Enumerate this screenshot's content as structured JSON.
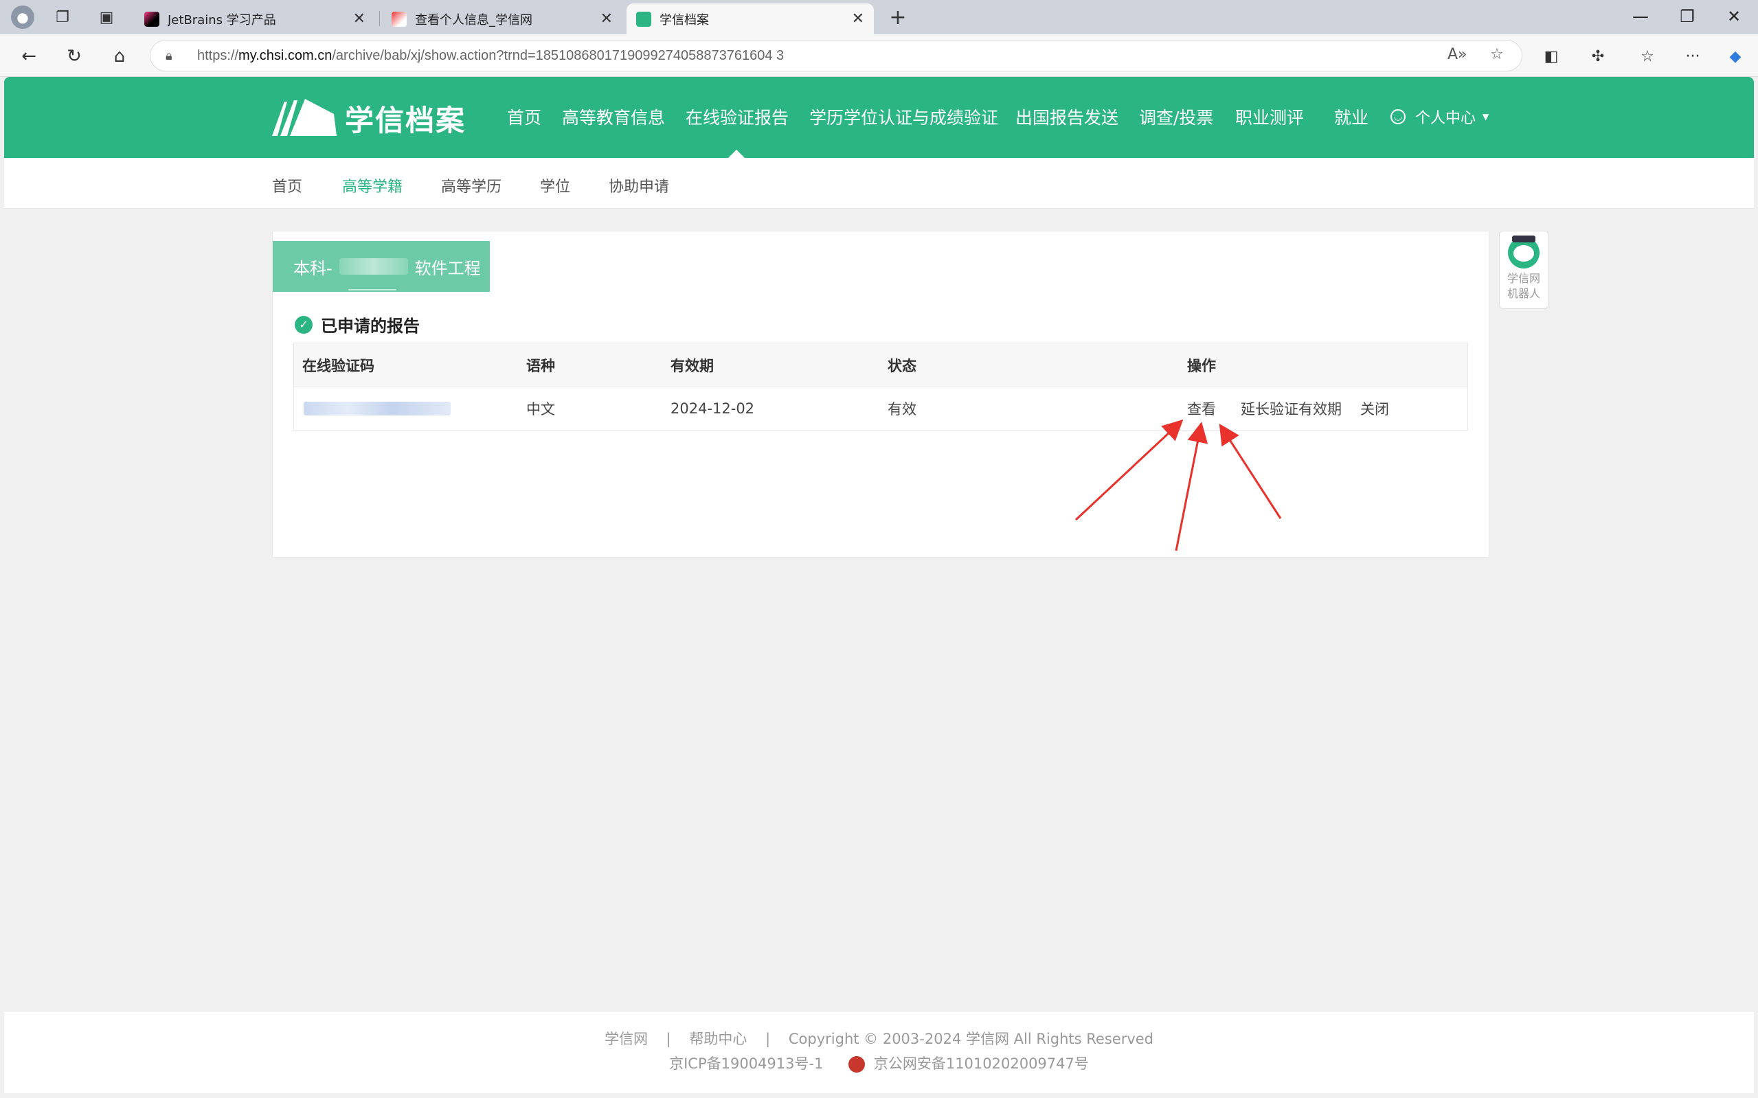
{
  "browser": {
    "tabs": [
      {
        "title": "JetBrains 学习产品",
        "active": false
      },
      {
        "title": "查看个人信息_学信网",
        "active": false
      },
      {
        "title": "学信档案",
        "active": true
      }
    ],
    "url_prefix": "https://",
    "url_host": "my.chsi.com.cn",
    "url_path": "/archive/bab/xj/show.action?trnd=1851086801719099274058873761604 3"
  },
  "site": {
    "logo_text": "学信档案",
    "main_nav": [
      "首页",
      "高等教育信息",
      "在线验证报告",
      "学历学位认证与成绩验证",
      "出国报告发送",
      "调查/投票",
      "职业测评",
      "就业"
    ],
    "active_nav_index": 2,
    "user_menu": "个人中心",
    "sub_nav": [
      "首页",
      "高等学籍",
      "高等学历",
      "学位",
      "协助申请"
    ],
    "active_sub_index": 1
  },
  "card": {
    "degree_prefix": "本科-",
    "degree_major": "软件工程",
    "section_title": "已申请的报告",
    "columns": [
      "在线验证码",
      "语种",
      "有效期",
      "状态",
      "操作"
    ],
    "rows": [
      {
        "code": "",
        "language": "中文",
        "expiry": "2024-12-02",
        "status": "有效",
        "actions": {
          "view": "查看",
          "extend": "延长验证有效期",
          "close": "关闭"
        }
      }
    ]
  },
  "robot": {
    "line1": "学信网",
    "line2": "机器人"
  },
  "footer": {
    "link1": "学信网",
    "link2": "帮助中心",
    "copyright": "Copyright © 2003-2024 学信网 All Rights Reserved",
    "icp": "京ICP备19004913号-1",
    "police": "京公网安备11010202009747号"
  },
  "colors": {
    "brand_green": "#2bb583",
    "link_blue": "#1e74c9",
    "annotation_red": "#e8322b"
  }
}
